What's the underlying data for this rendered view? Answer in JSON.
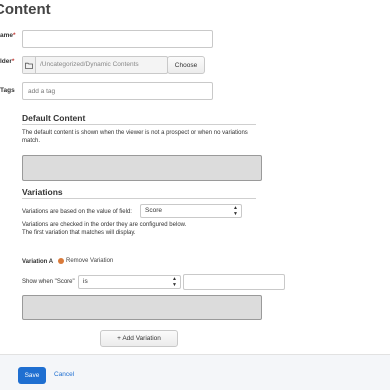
{
  "page": {
    "title": "Content"
  },
  "form": {
    "name_label": "ame",
    "name_required": "*",
    "name_value": "",
    "folder_label": "lder",
    "folder_required": "*",
    "folder_icon": "folder-icon",
    "folder_path": "/Uncategorized/Dynamic Contents",
    "choose_label": "Choose",
    "tags_label": "Tags",
    "tags_placeholder": "add a tag"
  },
  "default_content": {
    "title": "Default Content",
    "helper": "The default content is shown when the viewer is not a prospect or when no variations match."
  },
  "variations": {
    "title": "Variations",
    "based_on_label": "Variations are based on the value of field:",
    "field_selected": "Score",
    "order_helper_1": "Variations are checked in the order they are configured below.",
    "order_helper_2": "The first variation that matches will display.",
    "variation_a_label": "Variation A",
    "remove_label": "Remove Variation",
    "show_when_label": "Show when \"Score\"",
    "operator_selected": "is",
    "condition_value": "",
    "add_label": "+ Add Variation"
  },
  "footer": {
    "save_label": "Save",
    "cancel_label": "Cancel"
  },
  "colors": {
    "primary": "#1f6fd1",
    "required": "#c23934",
    "remove": "#d97a3a",
    "content_area": "#dcdcdc"
  }
}
